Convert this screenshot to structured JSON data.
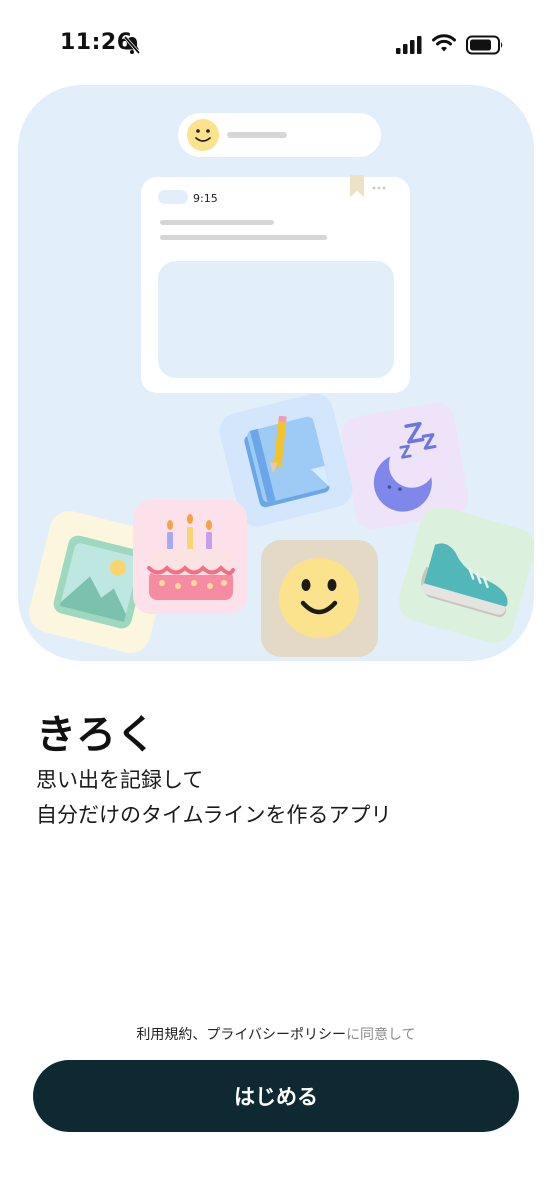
{
  "status_bar": {
    "time": "11:26",
    "icons": [
      "bell-slash-icon",
      "cellular-signal-icon",
      "wifi-icon",
      "battery-icon"
    ]
  },
  "hero": {
    "post_time": "9:15",
    "colors": {
      "background": "#e2effb",
      "smiley": "#fbe28c",
      "photo_tile": "#fdf6de",
      "cake_tile": "#fce0ea",
      "notebook_tile": "#d4e6fb",
      "sleep_tile": "#eee3f8",
      "face_tile": "#e4d9c6",
      "shoe_tile": "#dcf1dd"
    },
    "icons": [
      "smiley-face-icon",
      "photo-icon",
      "birthday-cake-icon",
      "notebook-pencil-icon",
      "sleep-moon-icon",
      "smiley-face-icon",
      "sneaker-icon"
    ]
  },
  "app": {
    "title": "きろく",
    "description_line1": "思い出を記録して",
    "description_line2": "自分だけのタイムラインを作るアプリ"
  },
  "terms": {
    "terms_link": "利用規約",
    "separator": "、",
    "privacy_link": "プライバシーポリシー",
    "suffix": "に同意して"
  },
  "start_button": {
    "label": "はじめる",
    "color": "#0e2931"
  }
}
